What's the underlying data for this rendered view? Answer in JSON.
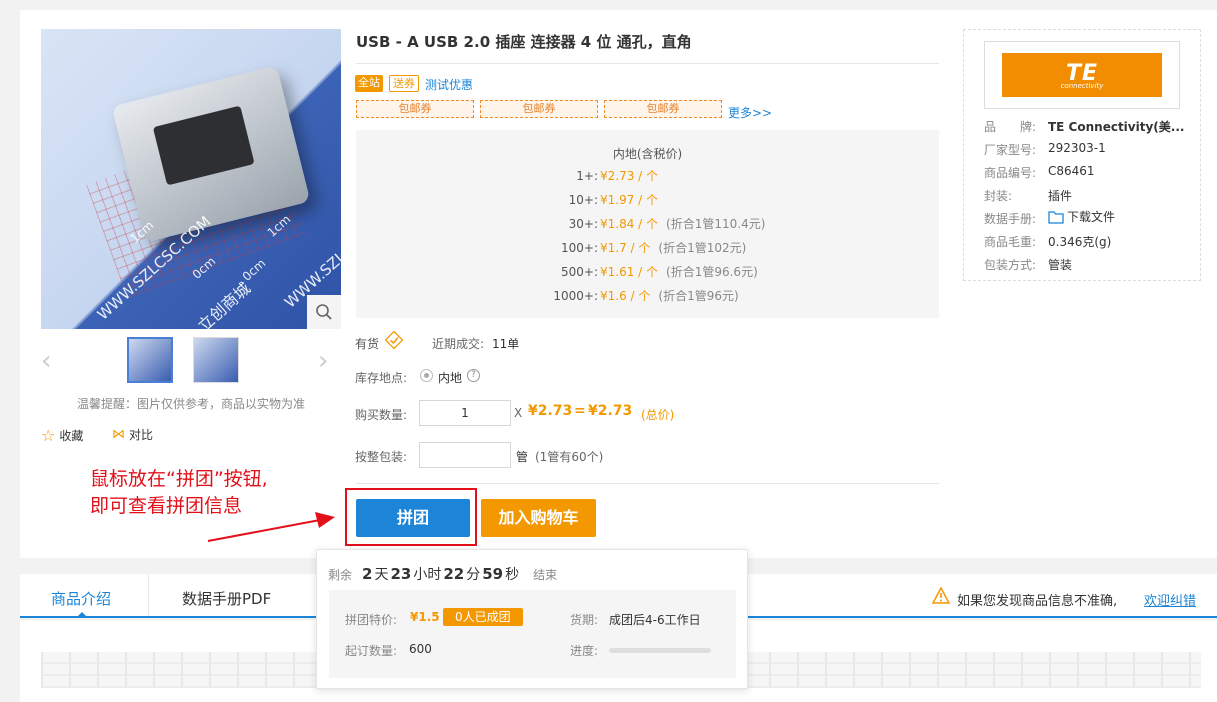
{
  "product": {
    "title": "USB - A USB 2.0 插座 连接器 4 位 通孔，直角",
    "tags": [
      "全站",
      "送券"
    ],
    "test_discount": "测试优惠",
    "coupons": [
      "包邮券",
      "包邮券",
      "包邮券"
    ],
    "more_coupons": "更多>>",
    "price_header": "内地(含税价)",
    "prices": [
      {
        "qty": "1+:",
        "price": "¥2.73 / 个",
        "note": ""
      },
      {
        "qty": "10+:",
        "price": "¥1.97 / 个",
        "note": ""
      },
      {
        "qty": "30+:",
        "price": "¥1.84 / 个",
        "note": "(折合1管110.4元)"
      },
      {
        "qty": "100+:",
        "price": "¥1.7 / 个",
        "note": "(折合1管102元)"
      },
      {
        "qty": "500+:",
        "price": "¥1.61 / 个",
        "note": "(折合1管96.6元)"
      },
      {
        "qty": "1000+:",
        "price": "¥1.6 / 个",
        "note": "(折合1管96元)"
      }
    ],
    "stock_status": "有货",
    "recent_deals_label": "近期成交:",
    "recent_deals_value": "11单",
    "stock_location_label": "库存地点:",
    "stock_location_value": "内地",
    "buy_qty_label": "购买数量:",
    "buy_qty_value": "1",
    "times": "X",
    "unit_price": "¥2.73",
    "equals": "=",
    "total_price": "¥2.73",
    "total_label": "(总价)",
    "pack_label": "按整包装:",
    "pack_unit": "管",
    "pack_note": "(1管有60个)",
    "group_buy_button": "拼团",
    "add_cart_button": "加入购物车"
  },
  "gallery": {
    "watermark": [
      "1cm",
      "1cm",
      "0cm",
      "0cm",
      "WWW.SZLCSC.COM",
      "立创商城",
      "WWW.SZLC"
    ],
    "tip": "温馨提醒：图片仅供参考，商品以实物为准",
    "favorite": "收藏",
    "compare": "对比"
  },
  "specs": {
    "brand_label": "品　　牌:",
    "brand_value": "TE Connectivity(美...",
    "mfr_label": "厂家型号:",
    "mfr_value": "292303-1",
    "code_label": "商品编号:",
    "code_value": "C86461",
    "package_label": "封装:",
    "package_value": "插件",
    "datasheet_label": "数据手册:",
    "datasheet_value": "下载文件",
    "weight_label": "商品毛重:",
    "weight_value": "0.346克(g)",
    "packing_label": "包装方式:",
    "packing_value": "管装",
    "logo_text": "TE",
    "logo_sub": "connectivity"
  },
  "tabs": {
    "items": [
      "商品介绍",
      "数据手册PDF"
    ],
    "warning_text": "如果您发现商品信息不准确,",
    "correction_link": "欢迎纠错"
  },
  "popup": {
    "remain": "剩余",
    "days": "2",
    "days_unit": "天",
    "hours": "23",
    "hours_unit": "小时",
    "minutes": "22",
    "minutes_unit": "分",
    "seconds": "59",
    "seconds_unit": "秒",
    "end": "结束",
    "special_price_label": "拼团特价:",
    "special_price": "¥1.5",
    "joined_badge": "0人已成团",
    "delivery_label": "货期:",
    "delivery_value": "成团后4-6工作日",
    "min_order_label": "起订数量:",
    "min_order_value": "600",
    "progress_label": "进度:",
    "progress": 0
  },
  "annotation": {
    "line1": "鼠标放在“拼团”按钮,",
    "line2": "即可查看拼团信息"
  },
  "colors": {
    "accent_orange": "#f39800",
    "blue_button": "#1c85d8",
    "orange_button": "#f39800",
    "annotation_red": "#e3101a"
  }
}
